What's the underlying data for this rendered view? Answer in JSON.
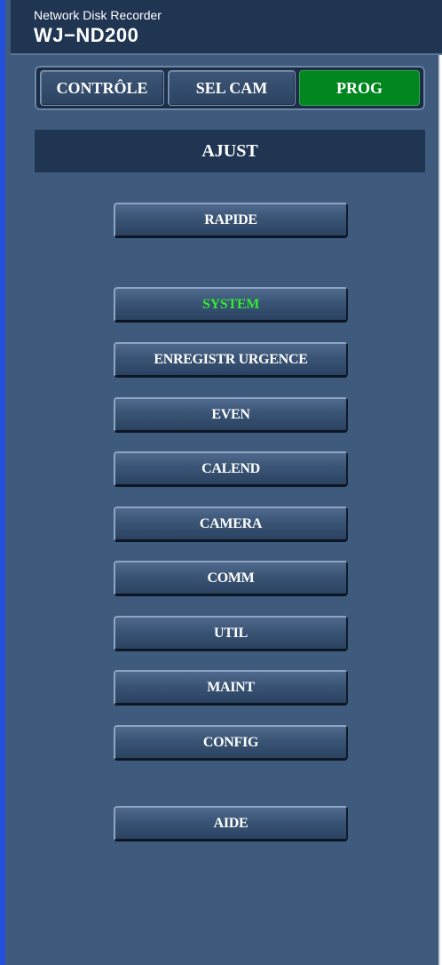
{
  "header": {
    "subtitle": "Network Disk Recorder",
    "model": "WJ−ND200"
  },
  "tabs": [
    {
      "label": "CONTRÔLE",
      "active": false
    },
    {
      "label": "SEL CAM",
      "active": false
    },
    {
      "label": "PROG",
      "active": true
    }
  ],
  "section": {
    "title": "AJUST"
  },
  "menu": {
    "rapide": "RAPIDE",
    "system": "SYSTEM",
    "enregistr_urgence": "ENREGISTR URGENCE",
    "even": "EVEN",
    "calend": "CALEND",
    "camera": "CAMERA",
    "comm": "COMM",
    "util": "UTIL",
    "maint": "MAINT",
    "config": "CONFIG",
    "aide": "AIDE"
  },
  "selected_item": "SYSTEM",
  "colors": {
    "panel_bg": "#3e5a7c",
    "header_bg": "#1f3552",
    "active_tab": "#00851f",
    "selected_text": "#34e834",
    "left_border": "#2250d8"
  }
}
